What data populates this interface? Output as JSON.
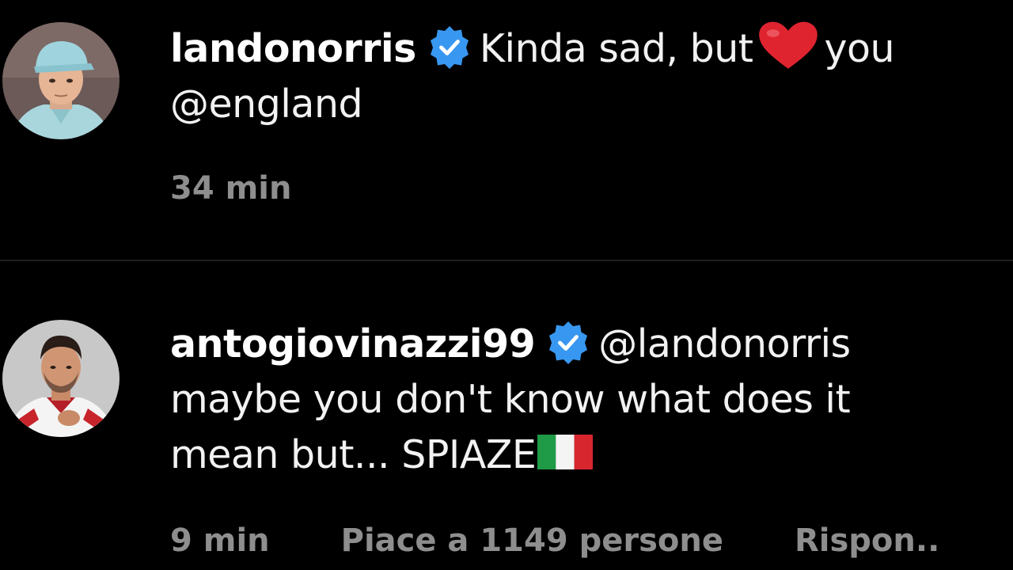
{
  "comments": [
    {
      "username": "landonorris",
      "verified_icon": "verified-badge-icon",
      "text_before_heart": "Kinda sad, but",
      "heart_icon": "red-heart-emoji",
      "text_after_heart": "you",
      "text_line2": "@england",
      "time": "34 min"
    },
    {
      "username": "antogiovinazzi99",
      "verified_icon": "verified-badge-icon",
      "mention": "@landonorris",
      "text_line2": "maybe you don't know what does it",
      "text_line3": "mean but... SPIAZE",
      "flag_icon": "italy-flag-emoji",
      "time": "9 min",
      "likes": "Piace a 1149 persone",
      "reply": "Rispon.."
    }
  ],
  "colors": {
    "background": "#000000",
    "verified_blue": "#3897f0",
    "meta_gray": "#8e8e8e",
    "heart_red": "#e0242f"
  }
}
